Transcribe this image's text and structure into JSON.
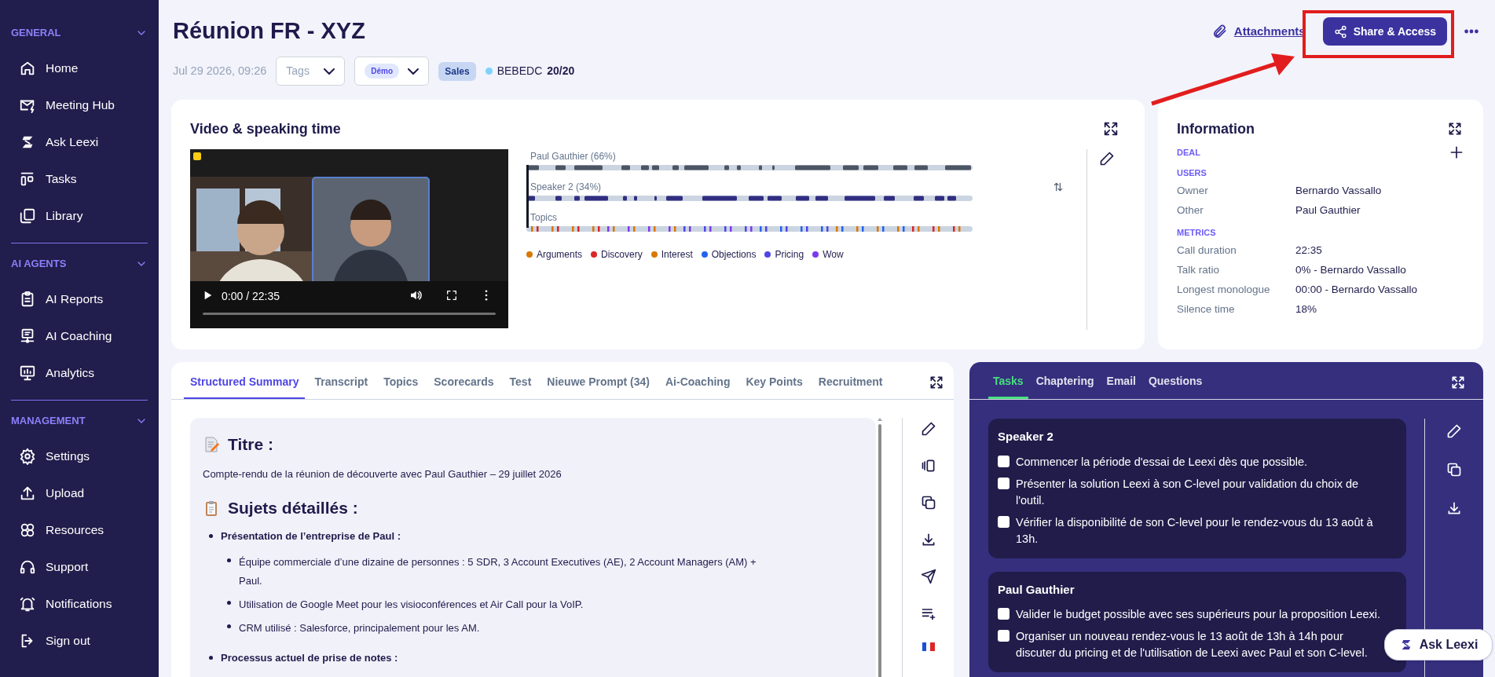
{
  "sidebar": {
    "sections": [
      {
        "title": "GENERAL",
        "expanded": true,
        "items": [
          {
            "label": "Home"
          },
          {
            "label": "Meeting Hub"
          },
          {
            "label": "Ask Leexi"
          },
          {
            "label": "Tasks"
          },
          {
            "label": "Library"
          }
        ]
      },
      {
        "title": "AI AGENTS",
        "expanded": true,
        "items": [
          {
            "label": "AI Reports"
          },
          {
            "label": "AI Coaching"
          },
          {
            "label": "Analytics"
          }
        ]
      },
      {
        "title": "MANAGEMENT",
        "expanded": true,
        "items": [
          {
            "label": "Settings"
          },
          {
            "label": "Upload"
          },
          {
            "label": "Resources"
          },
          {
            "label": "Support"
          },
          {
            "label": "Notifications"
          },
          {
            "label": "Sign out"
          }
        ]
      }
    ]
  },
  "header": {
    "title": "Réunion FR - XYZ",
    "date": "Jul 29 2026, 09:26",
    "tags_dropdown": {
      "placeholder": "Tags"
    },
    "type_dropdown": {
      "value": "Démo"
    },
    "badge": "Sales",
    "status": {
      "color": "#7dd3fc",
      "label": "BEBEDC",
      "score": "20/20"
    },
    "attachments": "Attachments",
    "share_button": "Share & Access"
  },
  "video_card": {
    "title": "Video & speaking time",
    "player_time": "0:00 / 22:35",
    "tracks": [
      {
        "label": "Paul Gauthier (66%)",
        "kind": "speaker",
        "color": "#4b5563"
      },
      {
        "label": "Speaker 2 (34%)",
        "kind": "speaker",
        "color": "#312e81"
      },
      {
        "label": "Topics",
        "kind": "topics"
      }
    ],
    "topics_legend": [
      {
        "label": "Arguments",
        "color": "#d97706"
      },
      {
        "label": "Discovery",
        "color": "#dc2626"
      },
      {
        "label": "Interest",
        "color": "#d97706"
      },
      {
        "label": "Objections",
        "color": "#2563eb"
      },
      {
        "label": "Pricing",
        "color": "#4f46e5"
      },
      {
        "label": "Wow",
        "color": "#7c3aed"
      }
    ]
  },
  "information": {
    "title": "Information",
    "sections": [
      {
        "heading": "DEAL"
      },
      {
        "heading": "USERS",
        "rows": [
          {
            "label": "Owner",
            "value": "Bernardo Vassallo"
          },
          {
            "label": "Other",
            "value": "Paul Gauthier"
          }
        ]
      },
      {
        "heading": "METRICS",
        "rows": [
          {
            "label": "Call duration",
            "value": "22:35"
          },
          {
            "label": "Talk ratio",
            "value": "0% - Bernardo Vassallo"
          },
          {
            "label": "Longest monologue",
            "value": "00:00 - Bernardo Vassallo"
          },
          {
            "label": "Silence time",
            "value": "18%"
          }
        ]
      }
    ]
  },
  "summary": {
    "tabs": [
      {
        "label": "Structured Summary",
        "selected": true
      },
      {
        "label": "Transcript",
        "selected": false
      },
      {
        "label": "Topics",
        "selected": false
      },
      {
        "label": "Scorecards",
        "selected": false
      },
      {
        "label": "Test",
        "selected": false
      },
      {
        "label": "Nieuwe Prompt (34)",
        "selected": false
      },
      {
        "label": "Ai-Coaching",
        "selected": false
      },
      {
        "label": "Key Points",
        "selected": false
      },
      {
        "label": "Recruitment",
        "selected": false
      }
    ],
    "blocks": [
      {
        "kind": "heading",
        "text": "Titre :"
      },
      {
        "kind": "paragraph",
        "text": "Compte-rendu de la réunion de découverte avec Paul Gauthier – 29 juillet 2026"
      },
      {
        "kind": "heading",
        "text": "Sujets détaillés :"
      },
      {
        "kind": "list",
        "items": [
          {
            "text": "Présentation de l’entreprise de Paul :",
            "children": [
              {
                "text": "Équipe commerciale d’une dizaine de personnes : 5 SDR, 3 Account Executives (AE), 2 Account Managers (AM) + Paul."
              },
              {
                "text": "Utilisation de Google Meet pour les visioconférences et Air Call pour la VoIP."
              },
              {
                "text": "CRM utilisé : Salesforce, principalement pour les AM."
              }
            ]
          },
          {
            "text": "Processus actuel de prise de notes :"
          }
        ]
      }
    ]
  },
  "tasks_panel": {
    "tabs": [
      {
        "label": "Tasks",
        "selected": true
      },
      {
        "label": "Chaptering",
        "selected": false
      },
      {
        "label": "Email",
        "selected": false
      },
      {
        "label": "Questions",
        "selected": false
      }
    ],
    "groups": [
      {
        "title": "Speaker 2",
        "tasks": [
          {
            "text": "Commencer la période d'essai de Leexi dès que possible.",
            "checked": false
          },
          {
            "text": "Présenter la solution Leexi à son C-level pour validation du choix de l'outil.",
            "checked": false
          },
          {
            "text": "Vérifier la disponibilité de son C-level pour le rendez-vous du 13 août à 13h.",
            "checked": false
          }
        ]
      },
      {
        "title": "Paul Gauthier",
        "tasks": [
          {
            "text": "Valider le budget possible avec ses supérieurs pour la proposition Leexi.",
            "checked": false
          },
          {
            "text": "Organiser un nouveau rendez-vous le 13 août de 13h à 14h pour discuter du pricing et de l'utilisation de Leexi avec Paul et son C-level.",
            "checked": false
          }
        ]
      }
    ]
  },
  "ask_button": "Ask Leexi"
}
